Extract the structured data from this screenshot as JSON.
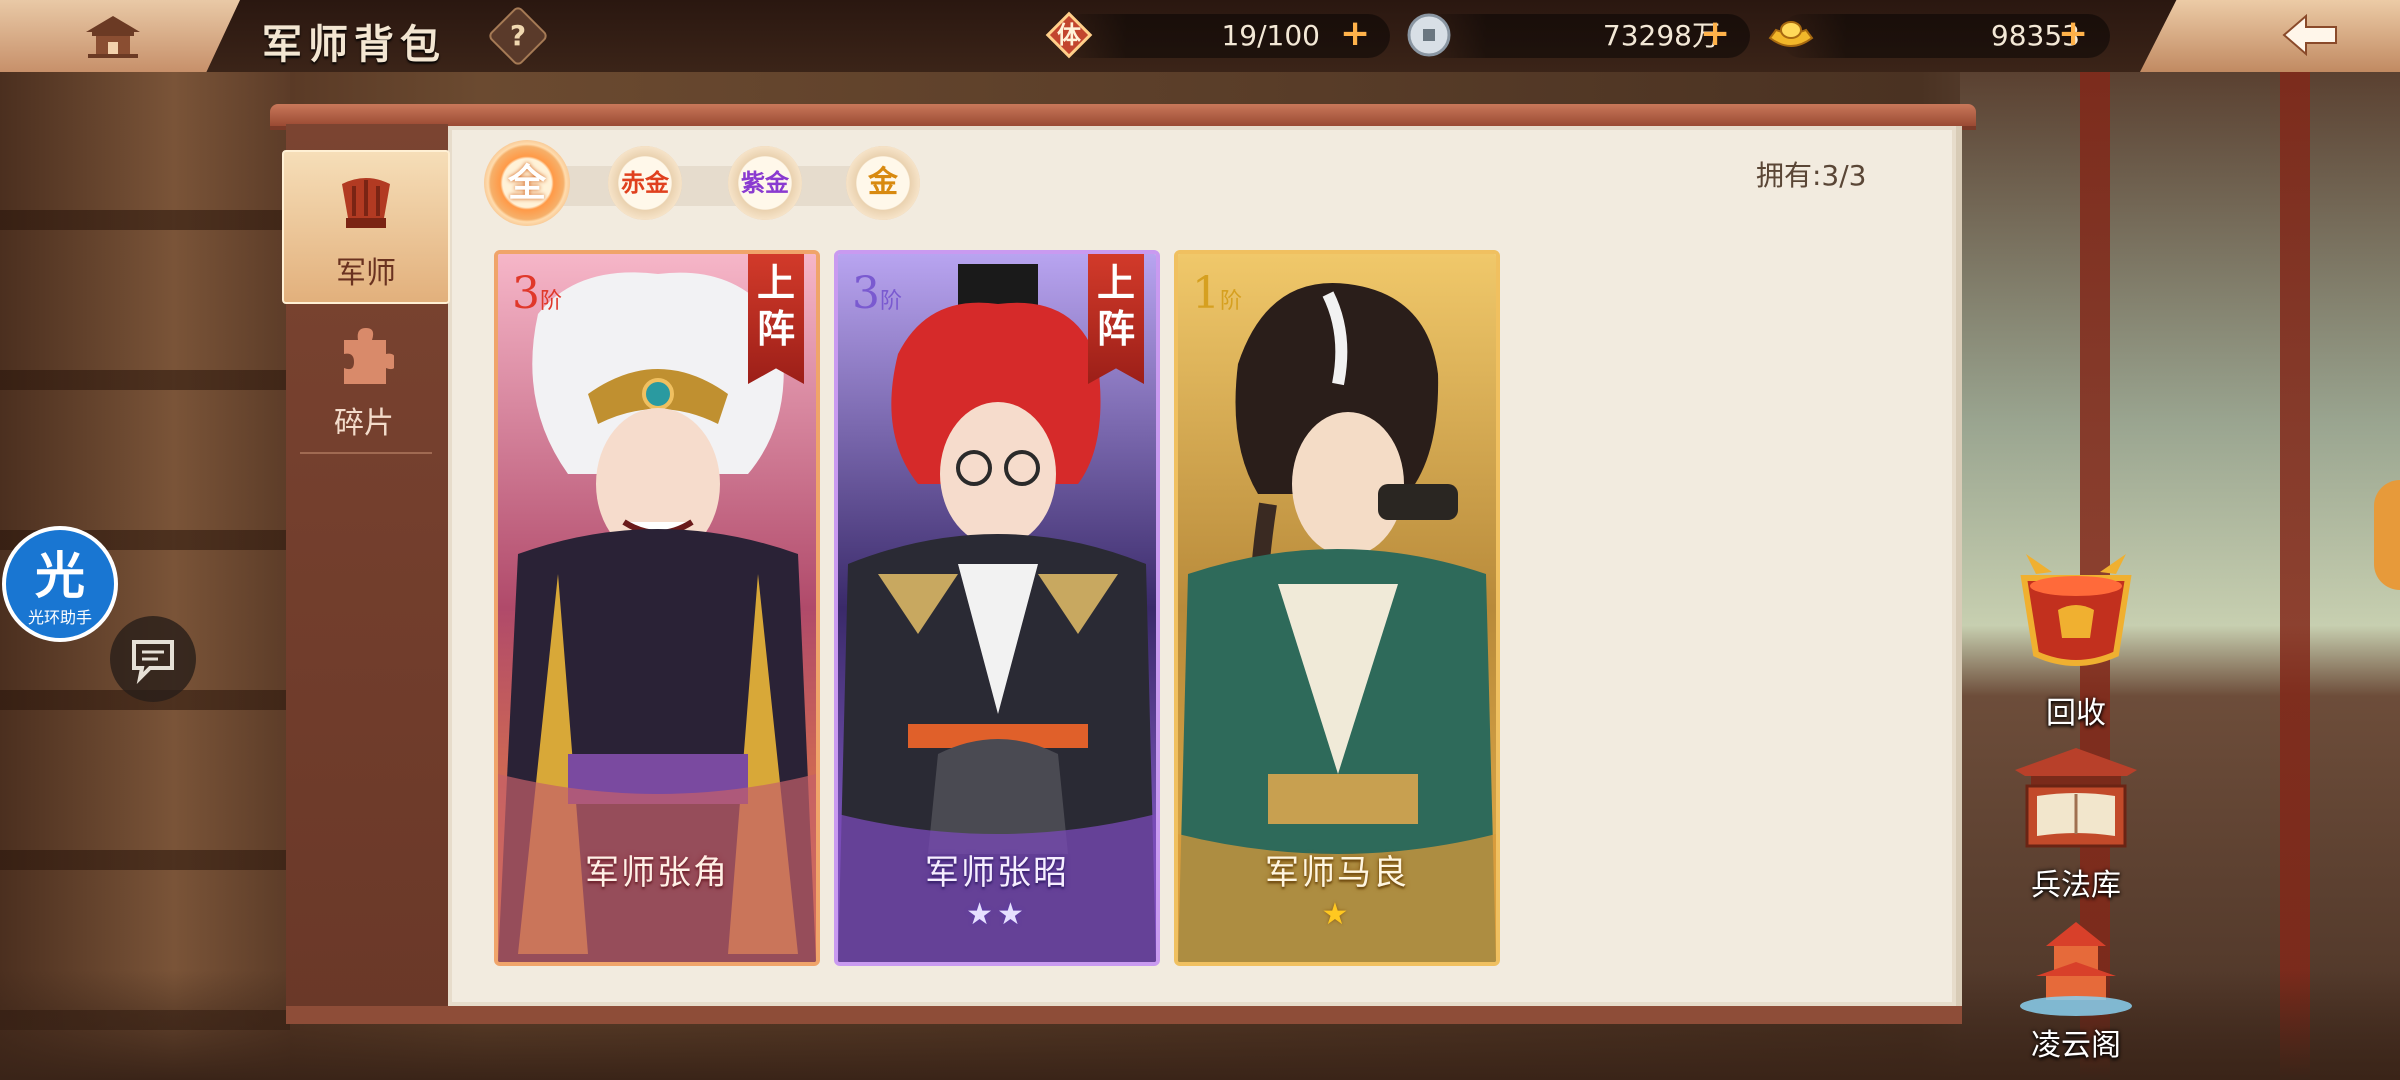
{
  "header": {
    "title": "军师背包",
    "help_symbol": "?",
    "stamina": {
      "icon_label": "体",
      "value": "19/100"
    },
    "silver": {
      "value": "73298万"
    },
    "gold": {
      "value": "98353"
    },
    "plus": "+"
  },
  "sidebar": {
    "tabs": [
      {
        "label": "军师",
        "active": true
      },
      {
        "label": "碎片",
        "active": false
      }
    ]
  },
  "filters": [
    {
      "label": "全",
      "active": true
    },
    {
      "label": "赤金",
      "active": false
    },
    {
      "label": "紫金",
      "active": false
    },
    {
      "label": "金",
      "active": false
    }
  ],
  "owned": "拥有:3/3",
  "cards": [
    {
      "tier": "3",
      "tier_unit": "阶",
      "deploy": "上阵",
      "name": "军师张角",
      "stars": 0,
      "rarity": "赤金"
    },
    {
      "tier": "3",
      "tier_unit": "阶",
      "deploy": "上阵",
      "name": "军师张昭",
      "stars": 2,
      "rarity": "紫金"
    },
    {
      "tier": "1",
      "tier_unit": "阶",
      "deploy": "",
      "name": "军师马良",
      "stars": 1,
      "rarity": "金"
    }
  ],
  "right_buttons": [
    {
      "label": "回收",
      "icon": "recycle-cauldron-icon"
    },
    {
      "label": "兵法库",
      "icon": "strategy-library-icon"
    },
    {
      "label": "凌云阁",
      "icon": "lingyun-pavilion-icon"
    }
  ],
  "helper": {
    "glyph": "光",
    "label": "光环助手"
  },
  "colors": {
    "accent_orange": "#ff9a48",
    "panel_brown": "#7b4431",
    "panel_paper": "#f2ebdf",
    "red_gold": "#ff5a3a",
    "purple_gold": "#9a5ad8",
    "gold": "#e8a62a"
  }
}
